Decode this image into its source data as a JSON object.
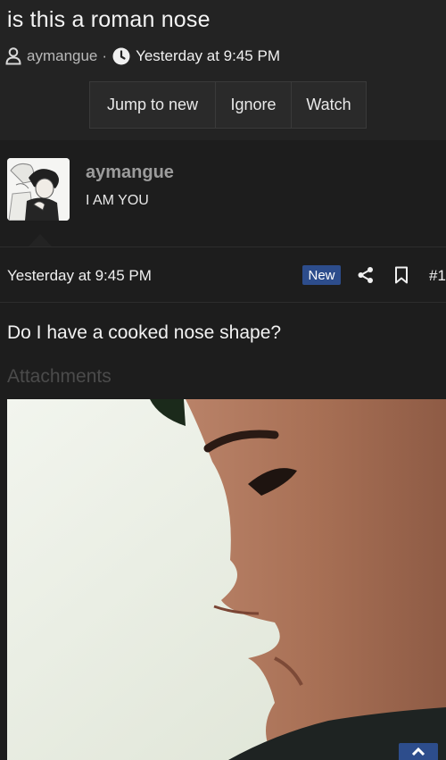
{
  "thread": {
    "title": "is this a roman nose",
    "author": "aymangue",
    "separator": "·",
    "date": "Yesterday at 9:45 PM",
    "buttons": {
      "jump_to_new": "Jump to new",
      "ignore": "Ignore",
      "watch": "Watch"
    }
  },
  "post": {
    "username": "aymangue",
    "user_title": "I AM YOU",
    "date": "Yesterday at 9:45 PM",
    "badge": "New",
    "number": "#1",
    "body": "Do I have a cooked nose shape?",
    "attachments_label": "Attachments"
  },
  "icons": {
    "user": "user-icon",
    "clock": "clock-icon",
    "share": "share-icon",
    "bookmark": "bookmark-icon",
    "scroll_top": "chevron-up-icon"
  },
  "colors": {
    "background": "#232323",
    "post_background": "#1d1d1d",
    "accent": "#2d4d8c",
    "username": "#9c9c9c"
  }
}
